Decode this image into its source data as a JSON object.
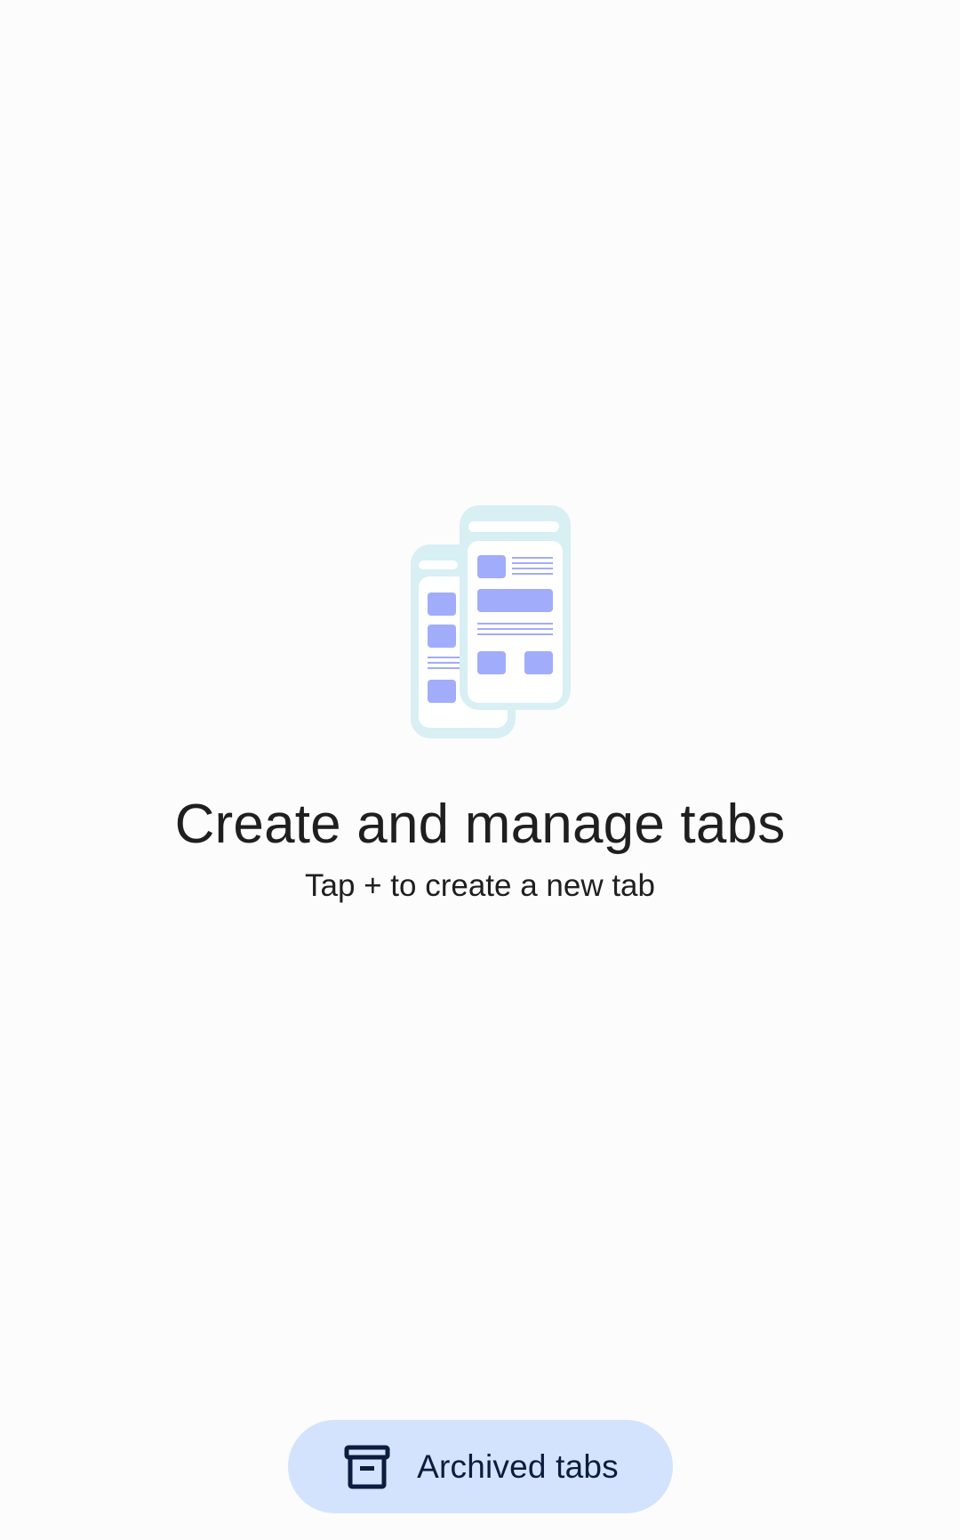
{
  "empty_state": {
    "illustration_icon": "stacked-tabs-illustration",
    "title": "Create and manage tabs",
    "subtitle": "Tap + to create a new tab"
  },
  "archived_button": {
    "icon": "archive-box-icon",
    "label": "Archived tabs"
  },
  "colors": {
    "background": "#fcfcfc",
    "text_primary": "#1f1f1f",
    "button_background": "#d3e3fd",
    "button_text": "#0b1d3f",
    "illustration_frame": "#d8eff4",
    "illustration_block": "#a1acfb"
  }
}
